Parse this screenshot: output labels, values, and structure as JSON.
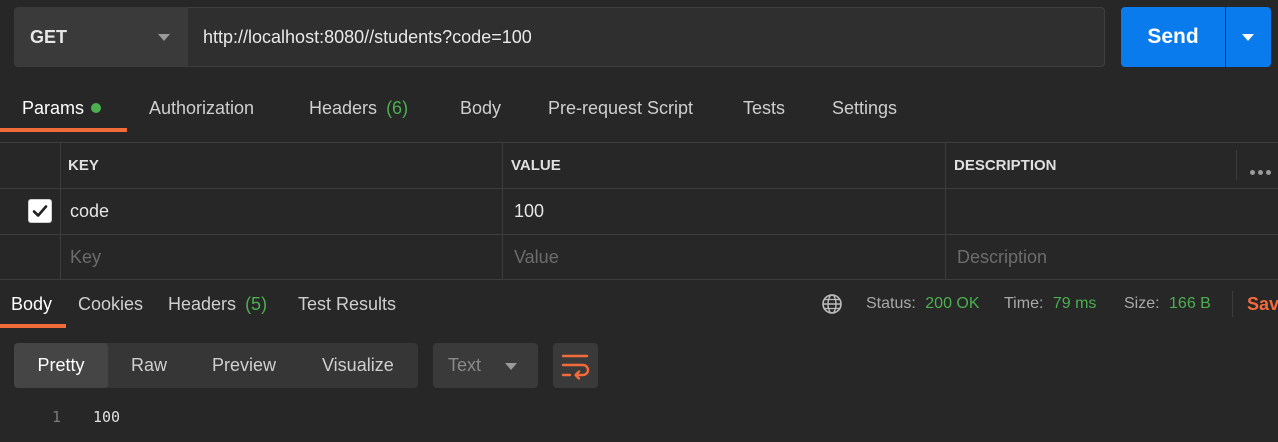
{
  "request": {
    "method": "GET",
    "url": "http://localhost:8080//students?code=100",
    "send_label": "Send"
  },
  "request_tabs": [
    {
      "label": "Params",
      "active": true,
      "indicator": "green-dot"
    },
    {
      "label": "Authorization"
    },
    {
      "label": "Headers",
      "count": "(6)"
    },
    {
      "label": "Body"
    },
    {
      "label": "Pre-request Script"
    },
    {
      "label": "Tests"
    },
    {
      "label": "Settings"
    }
  ],
  "params_table": {
    "headers": [
      "KEY",
      "VALUE",
      "DESCRIPTION"
    ],
    "rows": [
      {
        "checked": true,
        "key": "code",
        "value": "100",
        "description": ""
      }
    ],
    "placeholders": {
      "key": "Key",
      "value": "Value",
      "description": "Description"
    }
  },
  "response_tabs": [
    {
      "label": "Body",
      "active": true
    },
    {
      "label": "Cookies"
    },
    {
      "label": "Headers",
      "count": "(5)"
    },
    {
      "label": "Test Results"
    }
  ],
  "response_meta": {
    "status_label": "Status:",
    "status_value": "200 OK",
    "time_label": "Time:",
    "time_value": "79 ms",
    "size_label": "Size:",
    "size_value": "166 B",
    "save_label": "Sav"
  },
  "format_tabs": [
    {
      "label": "Pretty",
      "active": true
    },
    {
      "label": "Raw"
    },
    {
      "label": "Preview"
    },
    {
      "label": "Visualize"
    }
  ],
  "type_select": "Text",
  "response_body": [
    {
      "line": "1",
      "text": "100"
    }
  ],
  "colors": {
    "accent": "#f26b3a",
    "send": "#097bed",
    "success": "#4caf50",
    "background": "#272727"
  },
  "icons": [
    "chevron-down-icon",
    "globe-icon",
    "checkbox-check-icon",
    "more-horizontal-icon",
    "wrap-lines-icon"
  ]
}
